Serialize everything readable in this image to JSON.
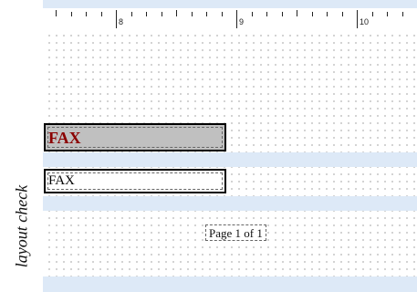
{
  "side_caption": "layout check",
  "ruler": {
    "labels": [
      "8",
      "9",
      "10"
    ]
  },
  "report": {
    "page_header_text": "FAX",
    "detail_text": "FAX",
    "page_footer_text": "Page 1 of 1"
  },
  "colors": {
    "section_band": "#dde9f7",
    "header_fill": "#c0c0c0",
    "header_text": "#8b0000"
  }
}
